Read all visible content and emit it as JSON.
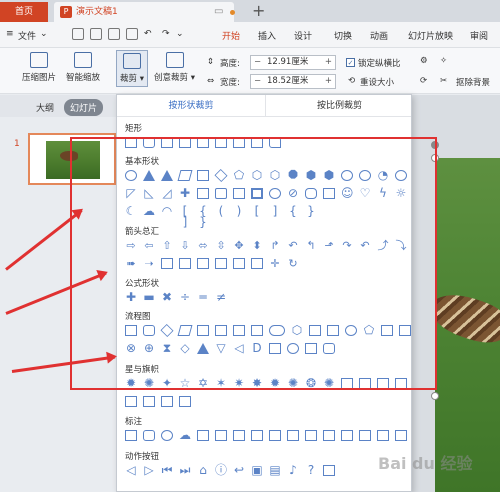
{
  "titlebar": {
    "home_tab": "首页",
    "doc_tab": "演示文稿1",
    "doc_icon": "P",
    "new_tab": "+"
  },
  "menubar": {
    "file": "文件",
    "items": [
      "开始",
      "插入",
      "设计",
      "切换",
      "动画",
      "幻灯片放映",
      "审阅"
    ]
  },
  "ribbon": {
    "compress": "压缩图片",
    "smart_scale": "智能缩放",
    "crop": "裁剪",
    "creative_crop": "创意裁剪",
    "height_label": "高度:",
    "height_value": "12.91厘米",
    "width_label": "宽度:",
    "width_value": "18.52厘米",
    "lock_ratio": "锁定纵横比",
    "reset_size": "重设大小",
    "remove_bg": "抠除背景"
  },
  "leftpanel": {
    "tab_outline": "大纲",
    "tab_slides": "幻灯片",
    "slide_number": "1"
  },
  "dropdown": {
    "tab_shape": "按形状裁剪",
    "tab_ratio": "按比例裁剪",
    "categories": {
      "rect": "矩形",
      "basic": "基本形状",
      "arrows": "箭头总汇",
      "formula": "公式形状",
      "flowchart": "流程图",
      "stars": "星与旗帜",
      "callouts": "标注",
      "action": "动作按钮"
    }
  },
  "watermark": "Bai du 经验",
  "colors": {
    "accent": "#d14424",
    "shape_stroke": "#5b83c6",
    "annotation": "#e03131"
  }
}
